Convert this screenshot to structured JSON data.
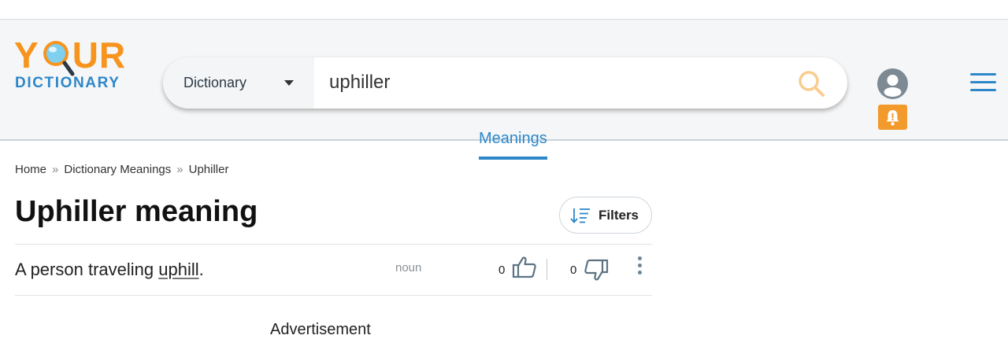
{
  "logo": {
    "word_top": "Y",
    "word_top_rest": "UR",
    "word_bottom": "DICTIONARY"
  },
  "search": {
    "scope_label": "Dictionary",
    "query": "uphiller",
    "placeholder": "uphiller"
  },
  "header": {
    "tabs": [
      {
        "label": "Meanings"
      }
    ]
  },
  "breadcrumb": {
    "items": [
      "Home",
      "Dictionary Meanings",
      "Uphiller"
    ],
    "separator": "»"
  },
  "page": {
    "title_word": "Uphiller",
    "title_rest": " meaning"
  },
  "filters": {
    "label": "Filters"
  },
  "definitions": [
    {
      "text_before": "A person traveling ",
      "link_text": "uphill",
      "text_after": ".",
      "part_of_speech": "noun",
      "upvotes": "0",
      "downvotes": "0"
    }
  ],
  "below_fold_text": "Advertisement",
  "colors": {
    "brand_orange": "#f7941d",
    "brand_blue": "#2d87c9",
    "bell_orange": "#f39a2c"
  }
}
